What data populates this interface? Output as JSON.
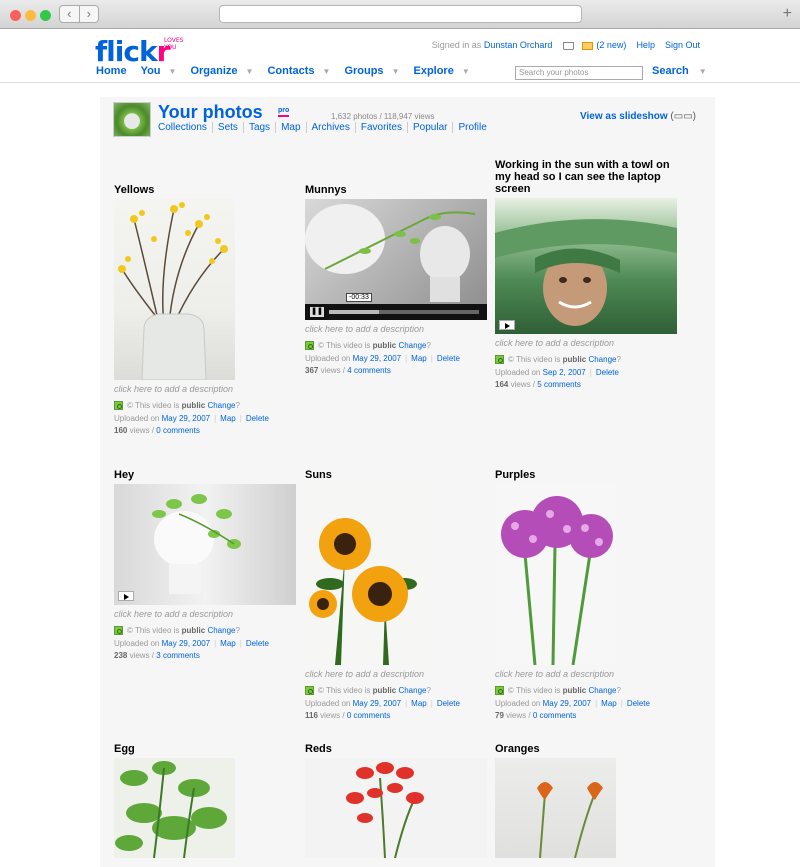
{
  "browser": {
    "back": "‹",
    "forward": "›",
    "new_tab": "+"
  },
  "header": {
    "logo": {
      "flick": "flick",
      "r": "r",
      "tm": "LOVES YOU"
    },
    "signed_in_prefix": "Signed in as",
    "user": "Dunstan Orchard",
    "mail_count": "(2 new)",
    "help": "Help",
    "sign_out": "Sign Out",
    "nav": {
      "home": "Home",
      "you": "You",
      "organize": "Organize",
      "contacts": "Contacts",
      "groups": "Groups",
      "explore": "Explore"
    },
    "search_placeholder": "Search your photos",
    "search_button": "Search"
  },
  "profile": {
    "title": "Your photos",
    "pro": "pro",
    "counts": "1,632 photos / 118,947 views",
    "links": [
      "Collections",
      "Sets",
      "Tags",
      "Map",
      "Archives",
      "Favorites",
      "Popular",
      "Profile"
    ],
    "slideshow": "View as slideshow",
    "slideshow_icon": "(▭▭)"
  },
  "common": {
    "desc": "click here to add a description",
    "video_public": "© This video is ",
    "public": "public",
    "change": "Change",
    "q": "?",
    "uploaded": "Uploaded on",
    "map": "Map",
    "delete": "Delete"
  },
  "photos": [
    {
      "title": "Yellows",
      "date": "May 29, 2007",
      "views": "160",
      "comments": "0 comments"
    },
    {
      "title": "Munnys",
      "date": "May 29, 2007",
      "views": "367",
      "comments": "4 comments",
      "time": "-00:33"
    },
    {
      "title": "Working in the sun with a towl on my head so I can see the laptop screen",
      "date": "Sep 2, 2007",
      "views": "164",
      "comments": "5 comments"
    },
    {
      "title": "Hey",
      "date": "May 29, 2007",
      "views": "238",
      "comments": "3 comments"
    },
    {
      "title": "Suns",
      "date": "May 29, 2007",
      "views": "116",
      "comments": "0 comments"
    },
    {
      "title": "Purples",
      "date": "May 29, 2007",
      "views": "79",
      "comments": "0 comments"
    },
    {
      "title": "Egg"
    },
    {
      "title": "Reds"
    },
    {
      "title": "Oranges"
    }
  ],
  "views_suffix": " views / "
}
